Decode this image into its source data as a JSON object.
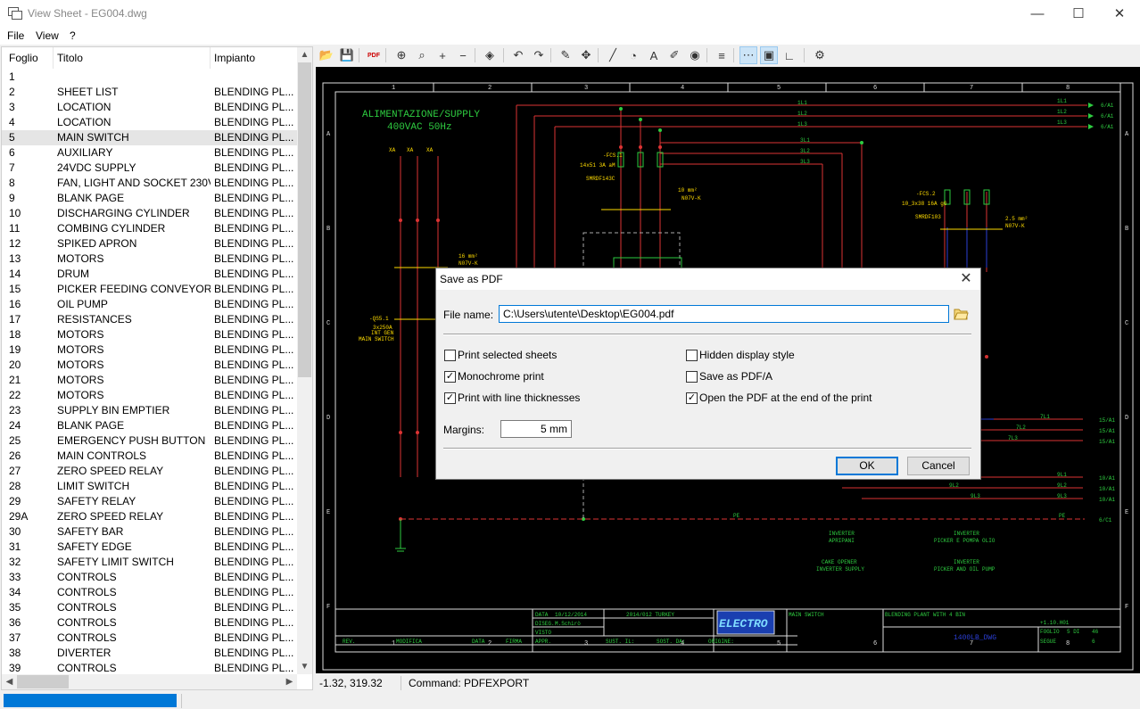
{
  "window": {
    "title": "View Sheet - EG004.dwg",
    "minimize": "—",
    "maximize": "☐",
    "close": "✕"
  },
  "menu": [
    "File",
    "View",
    "?"
  ],
  "sheet_list": {
    "headers": [
      "Foglio",
      "Titolo",
      "Impianto"
    ],
    "selected_index": 4,
    "rows": [
      [
        "1",
        "",
        ""
      ],
      [
        "2",
        "SHEET LIST",
        "BLENDING PL..."
      ],
      [
        "3",
        "LOCATION",
        "BLENDING PL..."
      ],
      [
        "4",
        "LOCATION",
        "BLENDING PL..."
      ],
      [
        "5",
        "MAIN SWITCH",
        "BLENDING PL..."
      ],
      [
        "6",
        "AUXILIARY",
        "BLENDING PL..."
      ],
      [
        "7",
        "24VDC SUPPLY",
        "BLENDING PL..."
      ],
      [
        "8",
        "FAN, LIGHT AND SOCKET 230V",
        "BLENDING PL..."
      ],
      [
        "9",
        "BLANK PAGE",
        "BLENDING PL..."
      ],
      [
        "10",
        "DISCHARGING CYLINDER",
        "BLENDING PL..."
      ],
      [
        "11",
        "COMBING CYLINDER",
        "BLENDING PL..."
      ],
      [
        "12",
        "SPIKED APRON",
        "BLENDING PL..."
      ],
      [
        "13",
        "MOTORS",
        "BLENDING PL..."
      ],
      [
        "14",
        "DRUM",
        "BLENDING PL..."
      ],
      [
        "15",
        "PICKER FEEDING CONVEYOR",
        "BLENDING PL..."
      ],
      [
        "16",
        "OIL PUMP",
        "BLENDING PL..."
      ],
      [
        "17",
        "RESISTANCES",
        "BLENDING PL..."
      ],
      [
        "18",
        "MOTORS",
        "BLENDING PL..."
      ],
      [
        "19",
        "MOTORS",
        "BLENDING PL..."
      ],
      [
        "20",
        "MOTORS",
        "BLENDING PL..."
      ],
      [
        "21",
        "MOTORS",
        "BLENDING PL..."
      ],
      [
        "22",
        "MOTORS",
        "BLENDING PL..."
      ],
      [
        "23",
        "SUPPLY BIN EMPTIER",
        "BLENDING PL..."
      ],
      [
        "24",
        "BLANK PAGE",
        "BLENDING PL..."
      ],
      [
        "25",
        "EMERGENCY PUSH BUTTON",
        "BLENDING PL..."
      ],
      [
        "26",
        "MAIN CONTROLS",
        "BLENDING PL..."
      ],
      [
        "27",
        "ZERO SPEED RELAY",
        "BLENDING PL..."
      ],
      [
        "28",
        "LIMIT SWITCH",
        "BLENDING PL..."
      ],
      [
        "29",
        "SAFETY RELAY",
        "BLENDING PL..."
      ],
      [
        "29A",
        "ZERO SPEED RELAY",
        "BLENDING PL..."
      ],
      [
        "30",
        "SAFETY BAR",
        "BLENDING PL..."
      ],
      [
        "31",
        "SAFETY EDGE",
        "BLENDING PL..."
      ],
      [
        "32",
        "SAFETY LIMIT SWITCH",
        "BLENDING PL..."
      ],
      [
        "33",
        "CONTROLS",
        "BLENDING PL..."
      ],
      [
        "34",
        "CONTROLS",
        "BLENDING PL..."
      ],
      [
        "35",
        "CONTROLS",
        "BLENDING PL..."
      ],
      [
        "36",
        "CONTROLS",
        "BLENDING PL..."
      ],
      [
        "37",
        "CONTROLS",
        "BLENDING PL..."
      ],
      [
        "38",
        "DIVERTER",
        "BLENDING PL..."
      ],
      [
        "39",
        "CONTROLS",
        "BLENDING PL..."
      ]
    ]
  },
  "toolbar": [
    {
      "name": "open-icon",
      "glyph": "📂"
    },
    {
      "name": "save-icon",
      "glyph": "💾"
    },
    {
      "name": "pdf-export-icon",
      "glyph": "PDF"
    },
    {
      "name": "zoom-extents-icon",
      "glyph": "⊕"
    },
    {
      "name": "zoom-window-icon",
      "glyph": "⌕"
    },
    {
      "name": "zoom-in-icon",
      "glyph": "+"
    },
    {
      "name": "zoom-out-icon",
      "glyph": "−"
    },
    {
      "name": "layers-icon",
      "glyph": "◈"
    },
    {
      "name": "undo-icon",
      "glyph": "↶"
    },
    {
      "name": "redo-icon",
      "glyph": "↷"
    },
    {
      "name": "pencil-icon",
      "glyph": "✎"
    },
    {
      "name": "pan-icon",
      "glyph": "✥"
    },
    {
      "name": "line-icon",
      "glyph": "╱"
    },
    {
      "name": "measure-icon",
      "glyph": "◔"
    },
    {
      "name": "text-icon",
      "glyph": "A"
    },
    {
      "name": "brush-icon",
      "glyph": "✐"
    },
    {
      "name": "color-wheel-icon",
      "glyph": "◉"
    },
    {
      "name": "align-icon",
      "glyph": "≡"
    },
    {
      "name": "grid-icon",
      "glyph": "⋯"
    },
    {
      "name": "frame-icon",
      "glyph": "▣"
    },
    {
      "name": "ortho-icon",
      "glyph": "∟"
    },
    {
      "name": "properties-icon",
      "glyph": "⚙"
    }
  ],
  "status": {
    "coords": "-1.32, 319.32",
    "command": "Command: PDFEXPORT",
    "progress": 1.0
  },
  "dialog": {
    "title": "Save as PDF",
    "file_label": "File name:",
    "file_value": "C:\\Users\\utente\\Desktop\\EG004.pdf",
    "options_left": [
      {
        "label": "Print selected sheets",
        "checked": false
      },
      {
        "label": "Monochrome print",
        "checked": true
      },
      {
        "label": "Print with line thicknesses",
        "checked": true
      }
    ],
    "options_right": [
      {
        "label": "Hidden display style",
        "checked": false
      },
      {
        "label": "Save as PDF/A",
        "checked": false
      },
      {
        "label": "Open the PDF at the end of the print",
        "checked": true
      }
    ],
    "margins_label": "Margins:",
    "margins_value": "5 mm",
    "ok": "OK",
    "cancel": "Cancel"
  },
  "drawing": {
    "supply_title_1": "ALIMENTAZIONE/SUPPLY",
    "supply_title_2": "400VAC 50Hz",
    "column_numbers": [
      "1",
      "2",
      "3",
      "4",
      "5",
      "6",
      "7",
      "8"
    ],
    "row_letters": [
      "A",
      "B",
      "C",
      "D",
      "E",
      "F"
    ],
    "phase_labels_top": [
      "1L1",
      "1L2",
      "1L3"
    ],
    "phase_refs_top": [
      "6/A1",
      "6/A1",
      "6/A1"
    ],
    "phase_labels_mid": [
      "3L1",
      "3L2",
      "3L3"
    ],
    "phase_labels_low": [
      "7L1",
      "7L2",
      "7L3"
    ],
    "phase_refs_low": [
      "15/A1",
      "15/A1",
      "15/A1"
    ],
    "phase_labels_e": [
      "9L1",
      "9L2",
      "9L3"
    ],
    "phase_refs_e": [
      "10/A1",
      "10/A1",
      "10/A1"
    ],
    "pe_label": "PE",
    "pe_ref": "6/C1",
    "fuse1_label": "-FCS.1",
    "fuse1_sub": "14x51 3A aM",
    "fuse1_code": "SMRDF143C",
    "fuse2_label": "-FCS.2",
    "fuse2_sub": "10_3x38 16A gG",
    "fuse2_code": "SMRDF103",
    "cable1": "10 mm²",
    "cable1_type": "N07V-K",
    "cable2": "2.5 mm²",
    "cable2_type": "N07V-K",
    "cable3": "16 mm²",
    "cable3_type": "N07V-K",
    "switch_label": "-QS5.1",
    "switch_sub": "3x250A",
    "switch_sub2": "INT GEN",
    "switch_sub3": "MAIN SWITCH",
    "xa_labels": [
      "XA",
      "XA",
      "XA"
    ],
    "note1_a": "INVERTER",
    "note1_b": "APRIPANI",
    "note2_a": "INVERTER",
    "note2_b": "PICKER E POMPA OLIO",
    "note3_a": "CAKE OPENER",
    "note3_b": "INVERTER SUPPLY",
    "note4_a": "INVERTER",
    "note4_b": "PICKER AND OIL PUMP",
    "tb_data_label": "DATA",
    "tb_data": "10/12/2014",
    "tb_dises_label": "DISEG.",
    "tb_dises": "M.Schirò",
    "tb_visto": "VISTO",
    "tb_appr": "APPR.",
    "tb_project": "2014/012 TURKEY",
    "tb_sheet_title": "MAIN SWITCH",
    "tb_plant": "BLENDING PLANT WITH 4 BIN",
    "tb_code": "+1.10.H01",
    "tb_drawing": "1400LB_DWG",
    "tb_foglio": "FOGLIO",
    "tb_foglio_val": "5 DI",
    "tb_foglio_tot": "46",
    "tb_segue": "SEGUE",
    "tb_segue_val": "6",
    "tb_rev": "REV.",
    "tb_modifica": "MODIFICA",
    "tb_data2": "DATA",
    "tb_firma": "FIRMA",
    "tb_sust_il": "SUST. IL:",
    "tb_sust_da": "SOST. DA:",
    "tb_origine": "ORIGINE:",
    "logo": "ELECTRO"
  }
}
